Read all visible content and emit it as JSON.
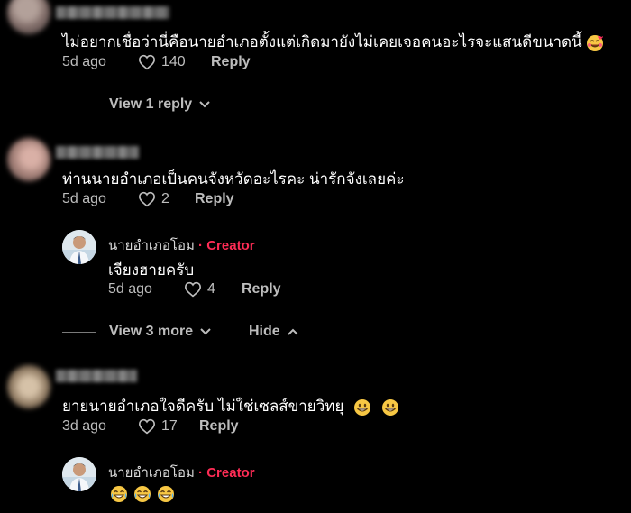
{
  "comments": [
    {
      "text": "ไม่อยากเชื่อว่านี่คือนายอำเภอตั้งแต่เกิดมายังไม่เคยเจอคนอะไรจะแสนดีขนาดนี้",
      "date": "5d ago",
      "likes": "140",
      "reply_label": "Reply",
      "view_replies": "View 1 reply",
      "emoji_icon": "smiling-face-with-hearts-icon"
    },
    {
      "text": "ท่านนายอำเภอเป็นคนจังหวัดอะไรคะ น่ารักจังเลยค่ะ",
      "date": "5d ago",
      "likes": "2",
      "reply_label": "Reply",
      "creator_reply": {
        "name": "นายอำเภอโอม",
        "separator": "·",
        "badge": "Creator",
        "text": "เจียงฮายครับ",
        "date": "5d ago",
        "likes": "4",
        "reply_label": "Reply"
      },
      "view_more": "View 3 more",
      "hide": "Hide"
    },
    {
      "text": "ยายนายอำเภอใจดีครับ ไม่ใช่เซลส์ขายวิทยุ",
      "date": "3d ago",
      "likes": "17",
      "reply_label": "Reply",
      "emoji_icon": "grinning-face-icon",
      "creator_reply": {
        "name": "นายอำเภอโอม",
        "separator": "·",
        "badge": "Creator",
        "emoji_icon": "tears-of-joy-icon"
      }
    }
  ],
  "colors": {
    "background": "#000000",
    "text": "#ffffff",
    "meta": "#bdbdbd",
    "creator_badge": "#fe2c55"
  }
}
